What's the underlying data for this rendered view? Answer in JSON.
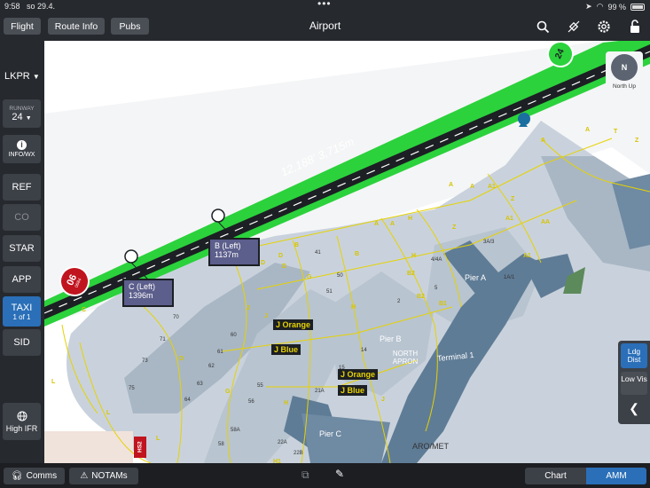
{
  "status": {
    "time": "9:58",
    "date": "so 29.4.",
    "battery": "99 %"
  },
  "nav": {
    "flight": "Flight",
    "route_info": "Route Info",
    "pubs": "Pubs",
    "title": "Airport"
  },
  "sidebar": {
    "airport": "LKPR",
    "runway_label": "RUNWAY",
    "runway_value": "24",
    "info": "INFO/WX",
    "ref": "REF",
    "co": "CO",
    "star": "STAR",
    "app": "APP",
    "taxi": "TAXI",
    "taxi_page": "1 of 1",
    "sid": "SID",
    "high_ifr": "High IFR"
  },
  "map": {
    "north_up": "North Up",
    "compass_n": "N",
    "runway_length": "12,188' 3,715m",
    "rwy_end_24": "24",
    "rwy_end_06": "06",
    "rwy_end_06_sub": "0684",
    "intersection_b": "B (Left)",
    "intersection_b_dist": "1137m",
    "intersection_c": "C (Left)",
    "intersection_c_dist": "1396m",
    "taxi_labels": [
      "J Orange",
      "J Blue",
      "J Orange",
      "J Blue"
    ],
    "pier_a": "Pier A",
    "pier_b": "Pier B",
    "pier_c": "Pier C",
    "north_apron": "NORTH APRON",
    "terminal_1": "Terminal 1",
    "aro_met": "ARO/MET",
    "hs2": "HS2"
  },
  "right": {
    "ldg_dist": "Ldg Dist",
    "low_vis": "Low Vis"
  },
  "bottom": {
    "comms": "Comms",
    "notams": "NOTAMs",
    "chart": "Chart",
    "amm": "AMM"
  },
  "colors": {
    "runway_green": "#2bd23c",
    "accent_blue": "#2a6fb8",
    "taxiway_yellow": "#e6d200",
    "rwy06_red": "#c0141e"
  }
}
